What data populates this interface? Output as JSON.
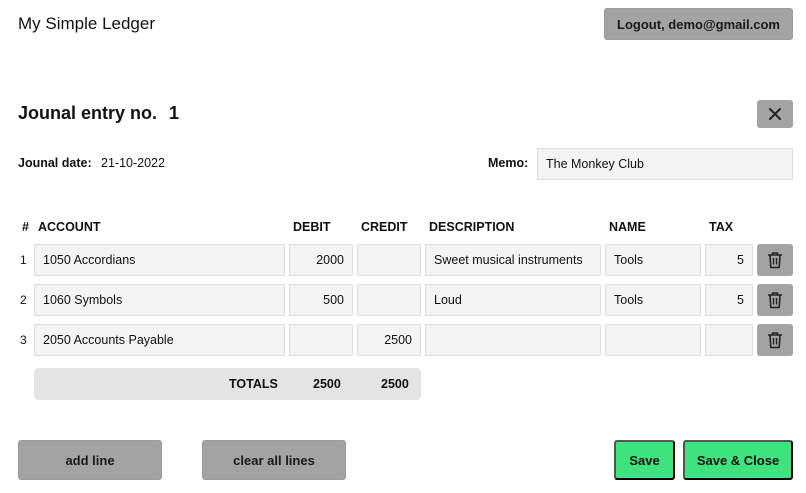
{
  "header": {
    "app_title": "My Simple Ledger",
    "logout_label": "Logout, demo@gmail.com"
  },
  "entry": {
    "title_label": "Jounal entry no.",
    "number": "1",
    "date_label": "Jounal date:",
    "date_value": "21-10-2022",
    "memo_label": "Memo:",
    "memo_value": "The Monkey Club"
  },
  "table": {
    "headers": {
      "num": "#",
      "account": "ACCOUNT",
      "debit": "DEBIT",
      "credit": "CREDIT",
      "description": "DESCRIPTION",
      "name": "NAME",
      "tax": "TAX"
    },
    "rows": [
      {
        "num": "1",
        "account": "1050 Accordians",
        "debit": "2000",
        "credit": "",
        "description": "Sweet musical instruments",
        "name": "Tools",
        "tax": "5"
      },
      {
        "num": "2",
        "account": "1060 Symbols",
        "debit": "500",
        "credit": "",
        "description": "Loud",
        "name": "Tools",
        "tax": "5"
      },
      {
        "num": "3",
        "account": "2050 Accounts Payable",
        "debit": "",
        "credit": "2500",
        "description": "",
        "name": "",
        "tax": ""
      }
    ],
    "totals": {
      "label": "TOTALS",
      "debit": "2500",
      "credit": "2500"
    }
  },
  "actions": {
    "add_line": "add line",
    "clear_all": "clear all lines",
    "save": "Save",
    "save_close": "Save & Close"
  },
  "icons": {
    "close": "close-icon",
    "delete": "trash-icon"
  },
  "colors": {
    "button_grey": "#a3a3a3",
    "button_green": "#3ee27f",
    "input_bg": "#f4f4f4",
    "totals_bg": "#e4e4e4"
  }
}
